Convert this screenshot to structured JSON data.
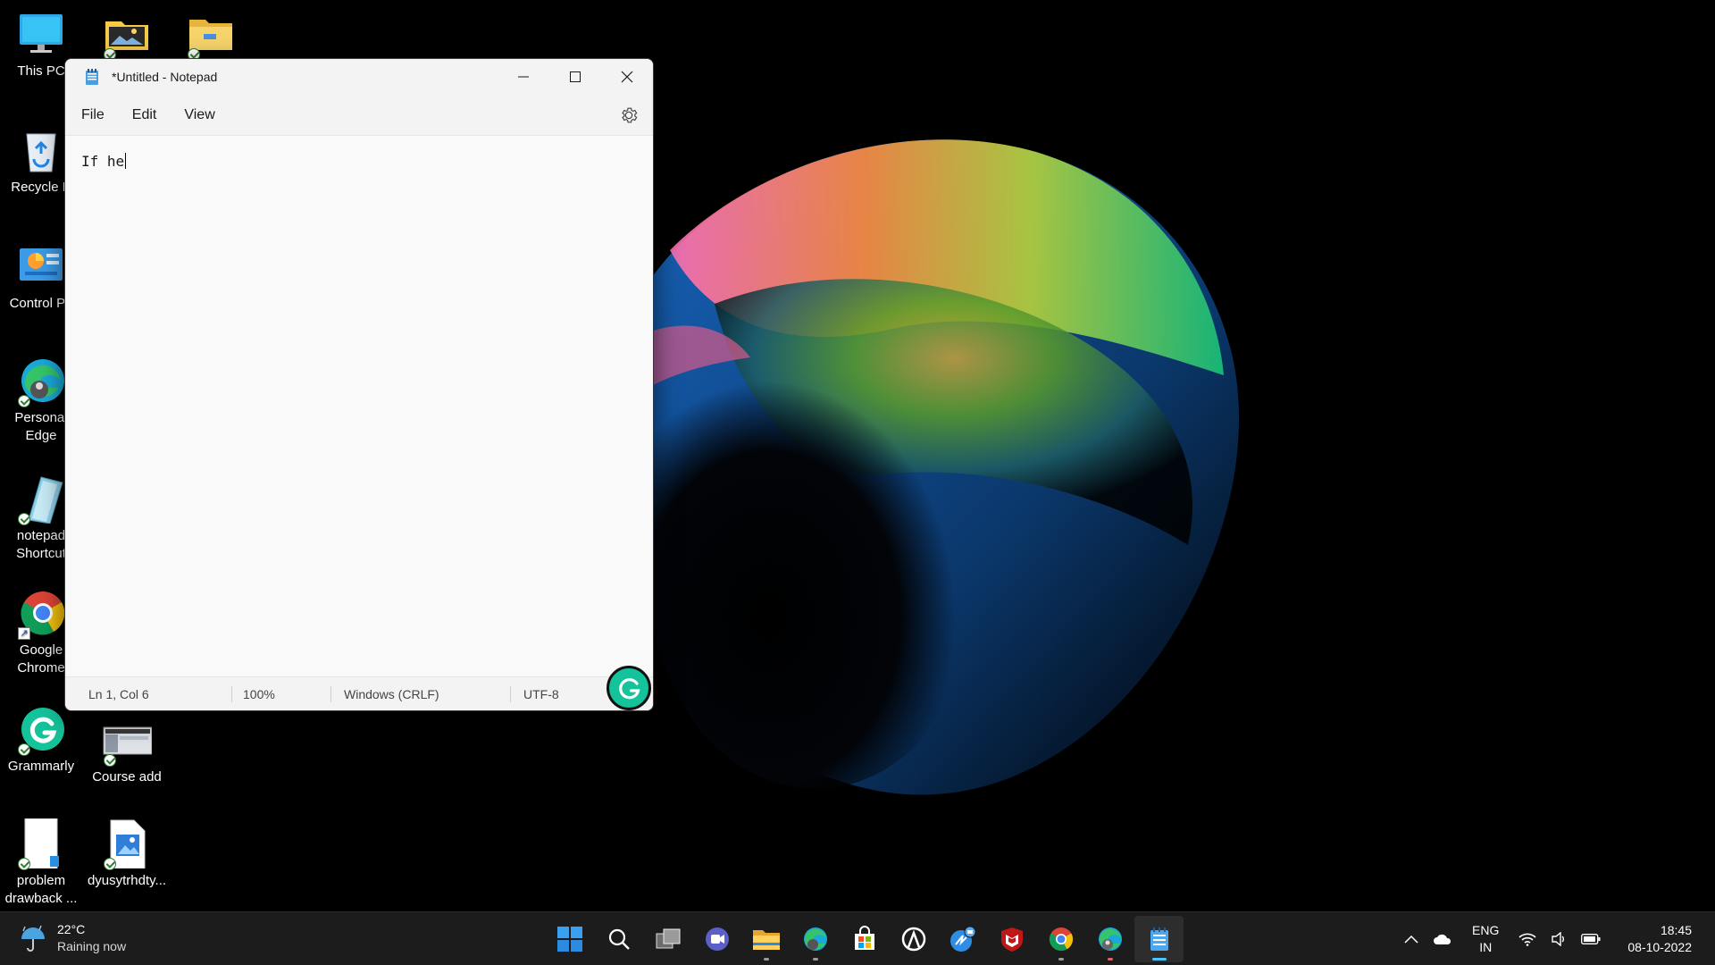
{
  "desktop": {
    "icons": [
      {
        "label": "This PC",
        "icon": "computer-icon"
      },
      {
        "label": "",
        "icon": "photos-folder-icon"
      },
      {
        "label": "",
        "icon": "folder-icon"
      },
      {
        "label": "Recycle B",
        "icon": "recycle-bin-icon"
      },
      {
        "label": "Control Pa",
        "icon": "control-panel-icon"
      },
      {
        "label": "Personal Edge",
        "icon": "edge-icon"
      },
      {
        "label": "notepad Shortcut",
        "icon": "notepad-shortcut-icon"
      },
      {
        "label": "Google Chrome",
        "icon": "chrome-icon"
      },
      {
        "label": "Grammarly",
        "icon": "grammarly-icon"
      },
      {
        "label": "Course add",
        "icon": "screenshot-file-icon"
      },
      {
        "label": "problem drawback ...",
        "icon": "document-icon"
      },
      {
        "label": "dyusytrhdty...",
        "icon": "image-file-icon"
      }
    ]
  },
  "notepad": {
    "title": "*Untitled - Notepad",
    "menu": {
      "file": "File",
      "edit": "Edit",
      "view": "View"
    },
    "content": "If he",
    "status": {
      "position": "Ln 1, Col 6",
      "zoom": "100%",
      "line_ending": "Windows (CRLF)",
      "encoding": "UTF-8"
    }
  },
  "taskbar": {
    "weather": {
      "temp": "22°C",
      "condition": "Raining now"
    },
    "apps": [
      "start-icon",
      "search-icon",
      "task-view-icon",
      "chat-icon",
      "file-explorer-icon",
      "edge-profile-icon",
      "store-icon",
      "app-icon",
      "messenger-icon",
      "mcafee-icon",
      "chrome-icon",
      "edge-dev-icon",
      "notepad-icon"
    ],
    "tray": {
      "lang_top": "ENG",
      "lang_bottom": "IN",
      "time": "18:45",
      "date": "08-10-2022"
    }
  },
  "colors": {
    "accent": "#4cc2ff",
    "grammarly": "#15c39a",
    "taskbar": "#1c1c1c"
  }
}
